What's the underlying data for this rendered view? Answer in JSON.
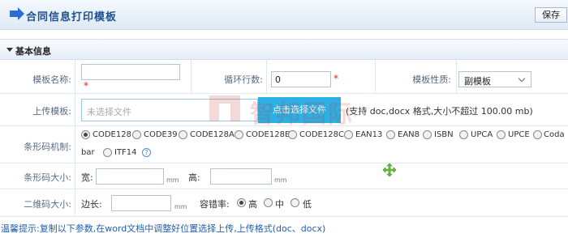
{
  "header": {
    "title": "合同信息打印模板",
    "save_label": "保存"
  },
  "section": {
    "title": "基本信息"
  },
  "form": {
    "template_name": {
      "label": "模板名称:",
      "value": ""
    },
    "loop_rows": {
      "label": "循环行数:",
      "value": "0"
    },
    "template_type": {
      "label": "模板性质:",
      "selected": "副模板"
    },
    "upload": {
      "label": "上传模板:",
      "placeholder": "未选择文件",
      "button": "点击选择文件",
      "hint": "(支持 doc,docx 格式,大小不超过 100.00 mb)"
    },
    "barcode_type": {
      "label": "条形码机制:",
      "options": [
        "CODE128",
        "CODE39",
        "CODE128A",
        "CODE128B",
        "CODE128C",
        "EAN13",
        "EAN8",
        "ISBN",
        "UPCA",
        "UPCE",
        "Coda",
        "bar",
        "ITF14"
      ],
      "selected": "CODE128",
      "help_icon": "question-icon"
    },
    "barcode_size": {
      "label": "条形码大小:",
      "width_label": "宽:",
      "height_label": "高:",
      "unit": "mm"
    },
    "qrcode_size": {
      "label": "二维码大小:",
      "side_label": "边长:",
      "unit": "mm",
      "ecc_label": "容错率:",
      "ecc_options": [
        "高",
        "中",
        "低"
      ],
      "ecc_selected": "高"
    },
    "required_mark": "*"
  },
  "watermark": {
    "text": "智邦国际"
  },
  "tip": "温馨提示:复制以下参数,在word文档中调整好位置选择上传,上传格式(doc、docx)",
  "colors": {
    "accent": "#2cb1e6",
    "title": "#1e4f8f",
    "required": "#e0211b",
    "tip": "#1e5fb0"
  },
  "cursor_icon": "move-icon"
}
